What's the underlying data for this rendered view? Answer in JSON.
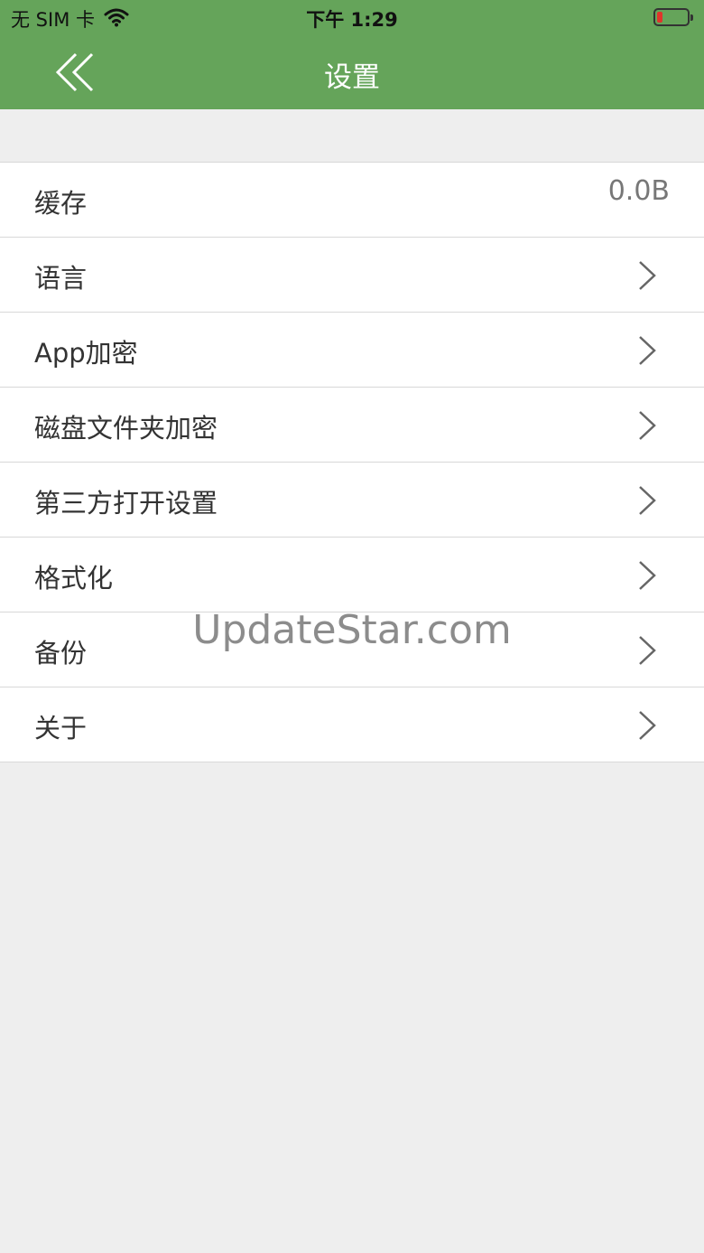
{
  "status_bar": {
    "carrier": "无 SIM 卡",
    "time": "下午 1:29",
    "wifi_icon": "wifi-icon",
    "battery_icon": "battery-low-icon"
  },
  "nav": {
    "title": "设置",
    "back_icon": "double-chevron-left-icon"
  },
  "settings": {
    "items": [
      {
        "label": "缓存",
        "value": "0.0B"
      },
      {
        "label": "语言",
        "icon": "chevron-right-icon"
      },
      {
        "label": "App加密",
        "icon": "chevron-right-icon"
      },
      {
        "label": "磁盘文件夹加密",
        "icon": "chevron-right-icon"
      },
      {
        "label": "第三方打开设置",
        "icon": "chevron-right-icon"
      },
      {
        "label": "格式化",
        "icon": "chevron-right-icon"
      },
      {
        "label": "备份",
        "icon": "chevron-right-icon"
      },
      {
        "label": "关于",
        "icon": "chevron-right-icon"
      }
    ]
  },
  "watermark": "UpdateStar.com",
  "colors": {
    "header_green": "#65a45a",
    "background": "#eeeeee",
    "battery_red": "#e0352b"
  }
}
